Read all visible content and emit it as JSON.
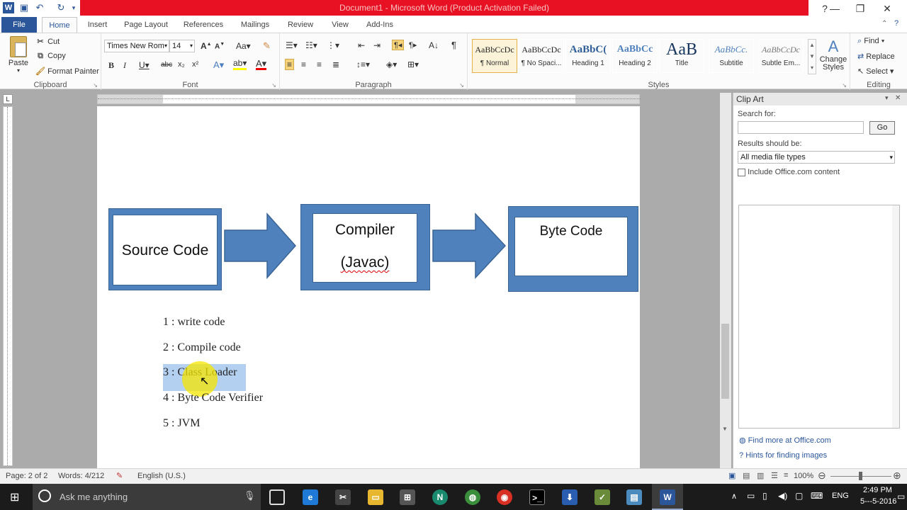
{
  "window": {
    "title": "Document1 - Microsoft Word (Product Activation Failed)"
  },
  "tabs": [
    "File",
    "Home",
    "Insert",
    "Page Layout",
    "References",
    "Mailings",
    "Review",
    "View",
    "Add-Ins"
  ],
  "clipboard": {
    "paste": "Paste",
    "cut": "Cut",
    "copy": "Copy",
    "format_painter": "Format Painter",
    "label": "Clipboard"
  },
  "font": {
    "name": "Times New Rom",
    "size": "14",
    "label": "Font"
  },
  "paragraph": {
    "label": "Paragraph"
  },
  "styles": {
    "label": "Styles",
    "items": [
      {
        "preview": "AaBbCcDc",
        "name": "¶ Normal"
      },
      {
        "preview": "AaBbCcDc",
        "name": "¶ No Spaci..."
      },
      {
        "preview": "AaBbC(",
        "name": "Heading 1"
      },
      {
        "preview": "AaBbCc",
        "name": "Heading 2"
      },
      {
        "preview": "AaB",
        "name": "Title"
      },
      {
        "preview": "AaBbCc.",
        "name": "Subtitle"
      },
      {
        "preview": "AaBbCcDc",
        "name": "Subtle Em..."
      }
    ],
    "change_styles": "Change Styles"
  },
  "editing": {
    "find": "Find",
    "replace": "Replace",
    "select": "Select",
    "label": "Editing"
  },
  "diagram": {
    "box1": "Source Code",
    "box2_line1": "Compiler",
    "box2_line2": "(Javac)",
    "box3": "Byte Code"
  },
  "list": [
    {
      "num": "1",
      "sep": " : ",
      "text": "write code"
    },
    {
      "num": "2",
      "sep": " : ",
      "text": "Compile code"
    },
    {
      "num": "3",
      "sep": " : ",
      "text": "Class Loader"
    },
    {
      "num": "4",
      "sep": " : ",
      "text": "Byte Code Verifier"
    },
    {
      "num": "5",
      "sep": " : ",
      "text": "JVM"
    }
  ],
  "clipart": {
    "title": "Clip Art",
    "search_label": "Search for:",
    "search_value": "",
    "go": "Go",
    "results_label": "Results should be:",
    "results_value": "All media file types",
    "include_office": "Include Office.com content",
    "find_more": "Find more at Office.com",
    "hints": "Hints for finding images"
  },
  "status": {
    "page": "Page: 2 of 2",
    "words": "Words: 4/212",
    "language": "English (U.S.)",
    "zoom": "100%"
  },
  "taskbar": {
    "search_placeholder": "Ask me anything",
    "lang": "ENG",
    "time": "2:49 PM",
    "date": "5---5-2016"
  },
  "colors": {
    "accent": "#2b579a",
    "titlebar": "#e81123",
    "shape_fill": "#4f81bd",
    "selection": "#b4d0f0",
    "highlight_cursor": "#f5e600"
  }
}
